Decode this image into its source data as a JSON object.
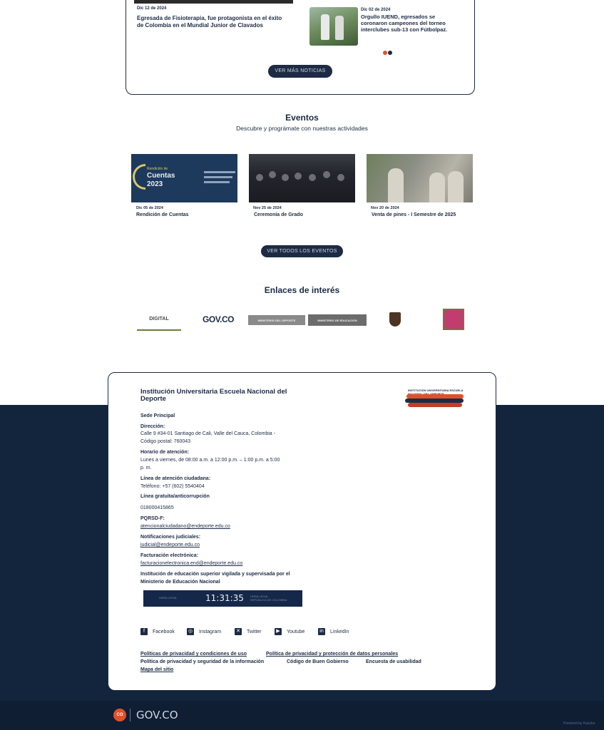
{
  "news": {
    "item1": {
      "date": "Dic 12 de 2024",
      "title": "Egresada de Fisioterapia, fue protagonista en el éxito de Colombia en el Mundial Junior de Clavados"
    },
    "item2": {
      "date": "Dic 02 de 2024",
      "title": "Orgullo IUEND, egresados se coronaron campeones del torneo interclubes sub-13 con Fútbolpaz."
    },
    "more_button": "VER MÁS NOTICIAS"
  },
  "events": {
    "title": "Eventos",
    "subtitle": "Descubre y prográmate con nuestras actividades",
    "items": [
      {
        "date": "Dic 05 de 2024",
        "name": "Rendición de Cuentas",
        "image_text": [
          "Rendición de",
          "Cuentas",
          "2023"
        ]
      },
      {
        "date": "Nov 25 de 2024",
        "name": "Ceremonia de Grado"
      },
      {
        "date": "Nov 20 de 2024",
        "name": "Venta de pines - I Semestre de 2025"
      }
    ],
    "all_button": "VER TODOS LOS EVENTOS"
  },
  "links": {
    "title": "Enlaces de interés",
    "logos": [
      "DIGITAL",
      "GOV.CO",
      "MINISTERIO DEL DEPORTE",
      "MINISTERIO DE EDUCACIÓN",
      "shield-logo",
      "co-logo"
    ]
  },
  "footer": {
    "institution": "Institución Universitaria Escuela Nacional del Deporte",
    "logo_text": "INSTITUCIÓN UNIVERSITARIA ESCUELA NACIONAL DEL DEPORTE",
    "sede": "Sede Principal",
    "direccion_label": "Dirección:",
    "direccion_1": "Calle 9 #34-01 Santiago de Cali, Valle del Cauca, Colombia -",
    "direccion_2": "Código postal: 760043",
    "horario_label": "Horario de atención:",
    "horario_1": "Lunes a viernes, de 08:00 a.m. a 12:00 p.m. – 1:00 p.m. a 5:00",
    "horario_2": "p. m.",
    "linea_label": "Línea de atención ciudadana:",
    "linea_value": "Teléfono: +57 (602) 5540404",
    "gratuita_label": "Línea gratuita/anticorrupción",
    "gratuita_value": "018000415865",
    "pqrsd_label": "PQRSD-F:",
    "pqrsd_value": "atencionalciudadano@endeporte.edu.co",
    "notif_label": "Notificaciones judiciales:",
    "notif_value": "judicial@endeporte.edu.co",
    "factura_label": "Facturación electrónica:",
    "factura_value": "facturacionelectronica.end@endeporte.edu.co",
    "vigilada_1": "Institución de educación superior vigilada y supervisada por el",
    "vigilada_2": "Ministerio de Educación Nacional",
    "clock": {
      "left": "HORA LEGAL",
      "time": "11:31:35",
      "right_1": "HORA LEGAL",
      "right_2": "REPÚBLICA DE COLOMBIA"
    },
    "social": [
      {
        "label": "Facebook",
        "icon": "facebook-icon",
        "glyph": "f"
      },
      {
        "label": "Instagram",
        "icon": "instagram-icon",
        "glyph": "◎"
      },
      {
        "label": "Twitter",
        "icon": "twitter-icon",
        "glyph": "✕"
      },
      {
        "label": "Youtube",
        "icon": "youtube-icon",
        "glyph": "▶"
      },
      {
        "label": "LinkedIn",
        "icon": "linkedin-icon",
        "glyph": "in"
      }
    ],
    "policies": {
      "p1": "Políticas de privacidad y condiciones de uso",
      "p2": "Política de privacidad y protección de datos personales",
      "p3": "Política de privacidad y seguridad de la información",
      "p4": "Código de Buen Gobierno",
      "p5": "Encuesta de usabilidad",
      "p6": "Mapa del sitio"
    }
  },
  "govco_bar": {
    "badge": "CO",
    "text": "GOV.CO"
  },
  "powered": "Powered by Kazuke",
  "colors": {
    "navy": "#1d2b44",
    "footer_bg": "#13243d",
    "accent": "#e2502a"
  }
}
